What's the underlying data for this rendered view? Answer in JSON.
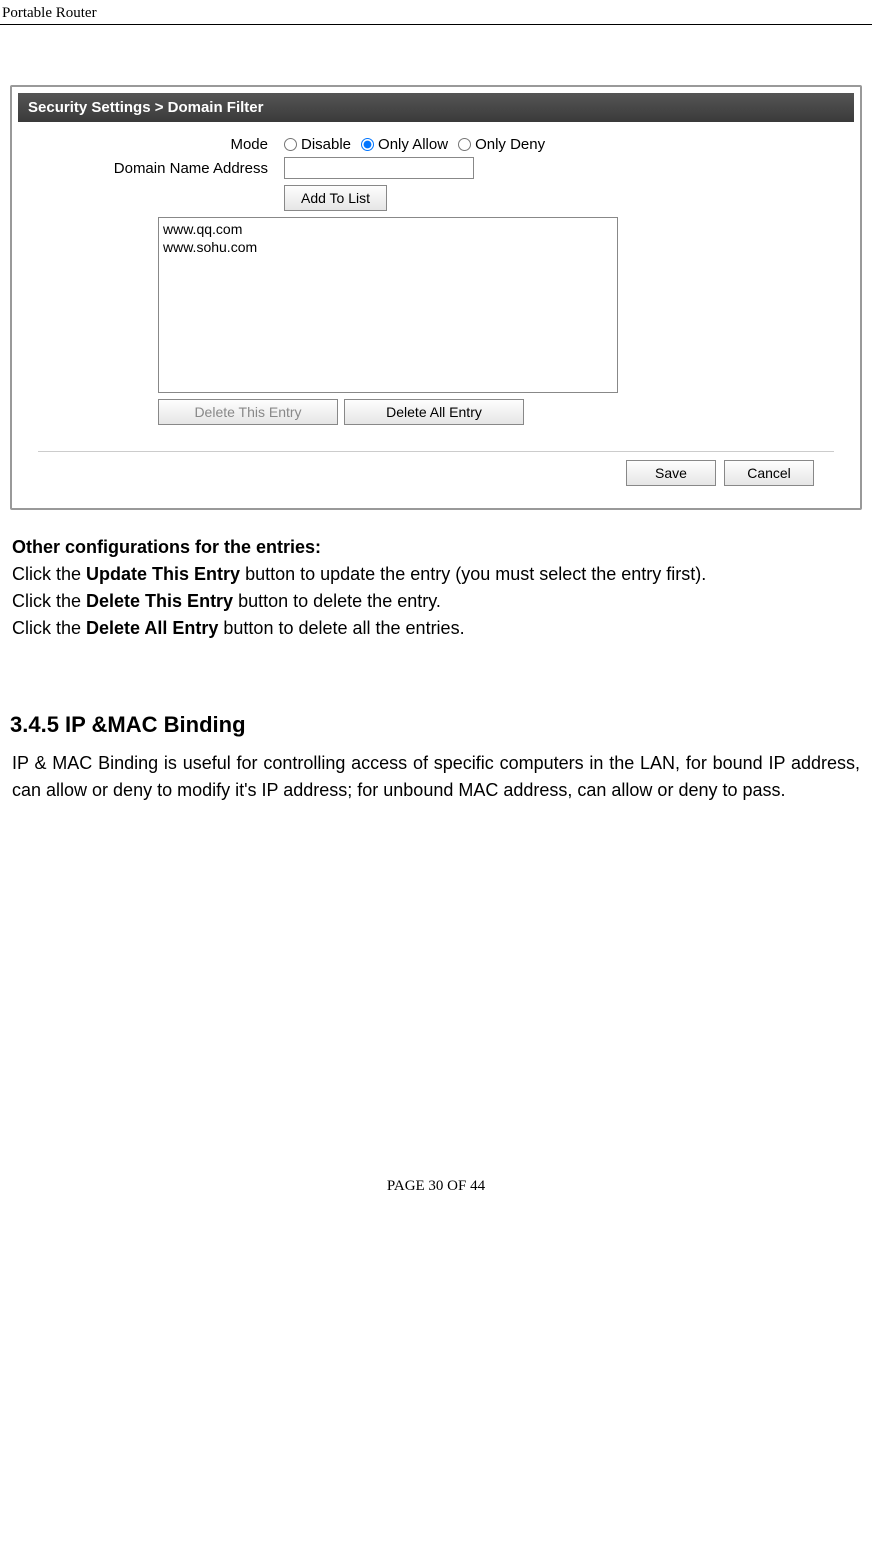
{
  "doc_header": "Portable Router",
  "panel": {
    "title": "Security Settings > Domain Filter",
    "mode_label": "Mode",
    "modes": {
      "disable": "Disable",
      "only_allow": "Only Allow",
      "only_deny": "Only Deny"
    },
    "domain_label": "Domain Name Address",
    "domain_value": "",
    "add_button": "Add To List",
    "list_items": [
      "www.qq.com",
      "www.sohu.com"
    ],
    "delete_this": "Delete This Entry",
    "delete_all": "Delete All Entry",
    "save": "Save",
    "cancel": "Cancel"
  },
  "instructions": {
    "heading": "Other configurations for the entries:",
    "line1_a": "Click the ",
    "line1_b": "Update This Entry",
    "line1_c": " button to update the entry (you must select the entry first).",
    "line2_a": "Click the ",
    "line2_b": "Delete This Entry",
    "line2_c": " button to delete the entry.",
    "line3_a": "Click the ",
    "line3_b": "Delete All Entry",
    "line3_c": " button to delete all the entries."
  },
  "section": {
    "heading": "3.4.5 IP &MAC Binding",
    "paragraph": "IP & MAC Binding is useful for controlling access of specific computers in the LAN, for bound IP address, can allow or deny to modify it's IP address; for unbound MAC address, can allow or deny to pass."
  },
  "footer": "PAGE  30  OF  44"
}
